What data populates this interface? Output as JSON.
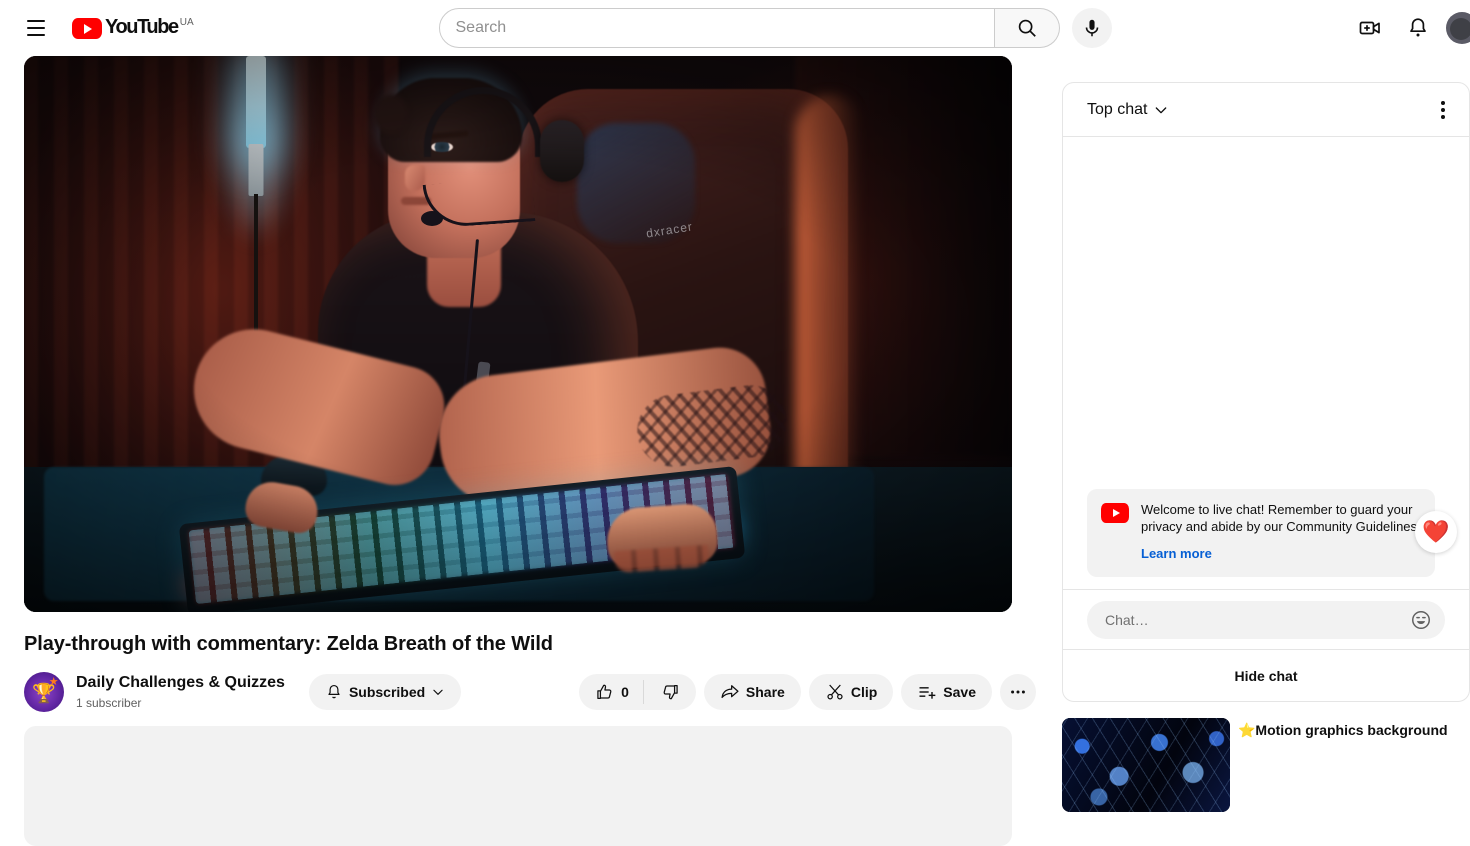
{
  "masthead": {
    "menu_icon": "hamburger-icon",
    "logo_text": "YouTube",
    "country_code": "UA",
    "search": {
      "value": "",
      "placeholder": "Search"
    },
    "search_icon": "search-icon",
    "mic_icon": "microphone-icon",
    "create_icon": "create-video-icon",
    "notifications_icon": "bell-icon",
    "avatar": "account-avatar"
  },
  "video": {
    "title": "Play-through with commentary: Zelda Breath of the Wild",
    "channel": {
      "name": "Daily Challenges & Quizzes",
      "subscribers": "1 subscriber",
      "avatar_icon": "trophy-avatar",
      "trophy_glyph": "🏆",
      "star_glyph": "★"
    },
    "subscribe": {
      "label": "Subscribed",
      "bell_icon": "bell-icon",
      "chevron_icon": "chevron-down-icon"
    },
    "actions": {
      "like": {
        "label": "0",
        "icon": "thumb-up-icon"
      },
      "dislike": {
        "icon": "thumb-down-icon"
      },
      "share": {
        "label": "Share",
        "icon": "share-arrow-icon"
      },
      "clip": {
        "label": "Clip",
        "icon": "scissors-icon"
      },
      "save": {
        "label": "Save",
        "icon": "save-playlist-icon"
      },
      "more": {
        "label": "•••",
        "icon": "more-horizontal-icon"
      }
    }
  },
  "chat": {
    "mode_label": "Top chat",
    "mode_chevron_icon": "chevron-down-icon",
    "menu_icon": "more-vertical-icon",
    "welcome": {
      "text": "Welcome to live chat! Remember to guard your privacy and abide by our Community Guidelines.",
      "link": "Learn more",
      "logo_icon": "youtube-logo-icon"
    },
    "heart": {
      "icon": "heart-icon",
      "glyph": "❤️"
    },
    "input": {
      "value": "",
      "placeholder": "Chat…"
    },
    "emoji_icon": "emoji-smile-icon",
    "hide_label": "Hide chat"
  },
  "recommended": [
    {
      "title": "⭐Motion graphics background",
      "thumbnail": "blue-stars-thumbnail"
    }
  ],
  "colors": {
    "brand_red": "#ff0000",
    "link_blue": "#065fd4",
    "text_primary": "#0f0f0f",
    "text_secondary": "#606060",
    "chip_bg": "#f2f2f2"
  }
}
